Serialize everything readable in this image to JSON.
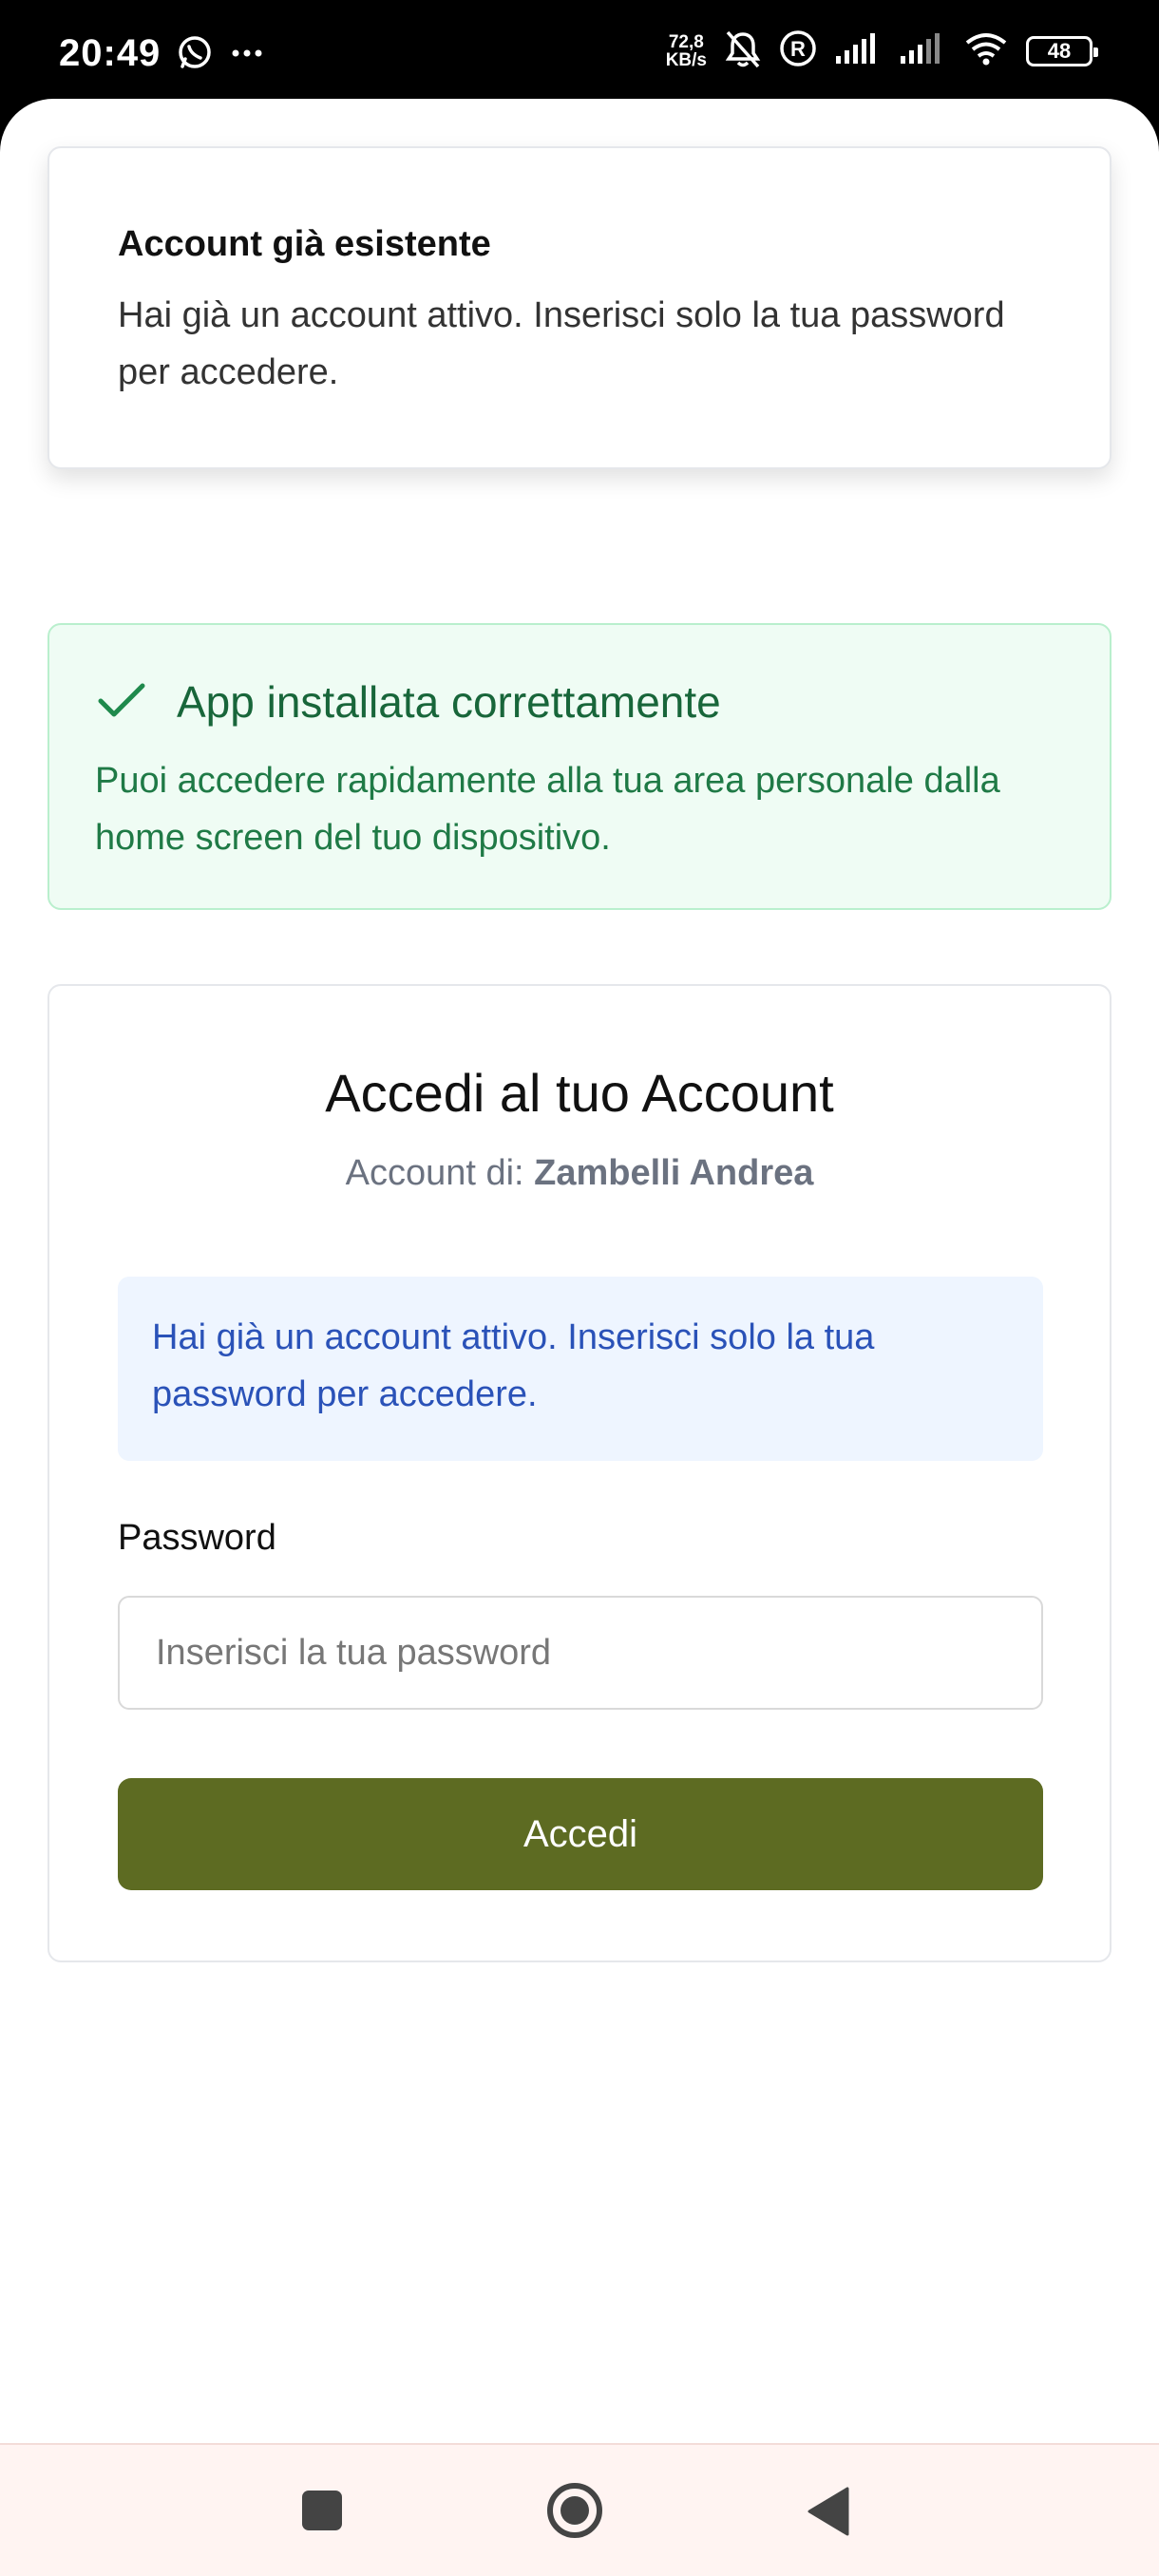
{
  "status_bar": {
    "time": "20:49",
    "speed_value": "72,8",
    "speed_unit": "KB/s",
    "battery": "48"
  },
  "toast": {
    "title": "Account già esistente",
    "text": "Hai già un account attivo. Inserisci solo la tua password per accedere."
  },
  "install_notice": {
    "title": "App installata correttamente",
    "text": "Puoi accedere rapidamente alla tua area personale dalla home screen del tuo dispositivo."
  },
  "login": {
    "title": "Accedi al tuo Account",
    "account_prefix": "Account di:",
    "account_name": "Zambelli Andrea",
    "info": "Hai già un account attivo. Inserisci solo la tua password per accedere.",
    "password_label": "Password",
    "password_placeholder": "Inserisci la tua password",
    "submit_label": "Accedi"
  },
  "colors": {
    "primary": "#5d6b22",
    "success_text": "#18663a",
    "info_text": "#2a52b8"
  }
}
